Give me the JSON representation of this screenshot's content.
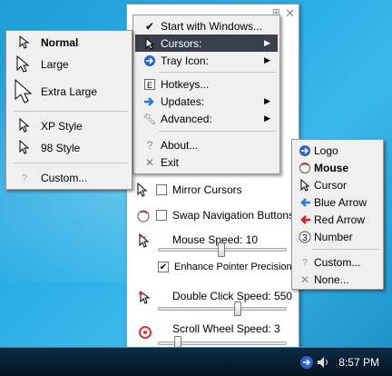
{
  "taskbar": {
    "clock": "8:57 PM"
  },
  "main_menu": {
    "items": [
      {
        "label": "Start with Windows...",
        "icon": "checkmark-icon"
      },
      {
        "label": "Cursors:",
        "icon": "cursor-icon",
        "submenu": true,
        "highlighted": true
      },
      {
        "label": "Tray Icon:",
        "icon": "tray-icon",
        "submenu": true
      },
      {
        "label": "Hotkeys...",
        "icon": "hotkey-icon"
      },
      {
        "label": "Updates:",
        "icon": "arrow-icon",
        "submenu": true
      },
      {
        "label": "Advanced:",
        "icon": "wrench-icon",
        "submenu": true
      },
      {
        "label": "About...",
        "icon": "question-icon"
      },
      {
        "label": "Exit",
        "icon": "close-icon"
      }
    ]
  },
  "cursors_menu": {
    "items": [
      {
        "label": "Normal",
        "bold": true
      },
      {
        "label": "Large"
      },
      {
        "label": "Extra Large"
      },
      {
        "label": "XP Style"
      },
      {
        "label": "98 Style"
      },
      {
        "label": "Custom..."
      }
    ]
  },
  "tray_menu": {
    "items": [
      {
        "label": "Logo"
      },
      {
        "label": "Mouse",
        "bold": true
      },
      {
        "label": "Cursor"
      },
      {
        "label": "Blue Arrow"
      },
      {
        "label": "Red Arrow"
      },
      {
        "label": "Number"
      },
      {
        "label": "Custom..."
      },
      {
        "label": "None..."
      }
    ]
  },
  "panel": {
    "mirror_cursors": "Mirror Cursors",
    "swap_buttons": "Swap Navigation Buttons",
    "mouse_speed": "Mouse Speed: 10",
    "mouse_speed_value": 10,
    "enhance_precision": "Enhance Pointer Precision",
    "enhance_checked": true,
    "double_click": "Double Click Speed: 550",
    "double_click_value": 550,
    "scroll_speed": "Scroll Wheel Speed: 3",
    "scroll_speed_value": 3
  },
  "colors": {
    "highlight": "#3a3f4a",
    "menu_bg": "#f0f0f0",
    "desktop": "#2aaee6"
  }
}
